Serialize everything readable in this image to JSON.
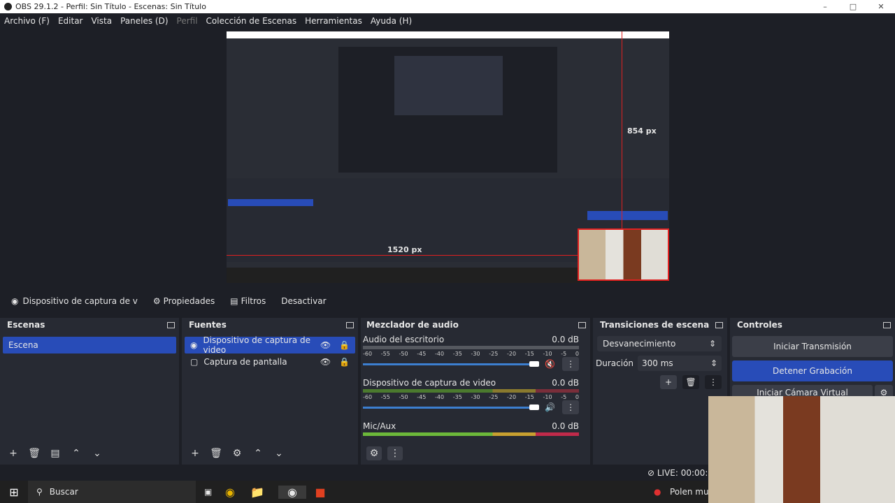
{
  "window": {
    "title": "OBS 29.1.2 - Perfil: Sin Título - Escenas: Sin Título"
  },
  "menu": [
    "Archivo (F)",
    "Editar",
    "Vista",
    "Paneles (D)",
    "Perfil",
    "Colección de Escenas",
    "Herramientas",
    "Ayuda (H)"
  ],
  "preview": {
    "height_label": "854 px",
    "width_label": "1520 px"
  },
  "source_toolbar": {
    "source": "Dispositivo de captura de v",
    "properties": "Propiedades",
    "filters": "Filtros",
    "deactivate": "Desactivar"
  },
  "scenes": {
    "title": "Escenas",
    "items": [
      "Escena"
    ]
  },
  "sources": {
    "title": "Fuentes",
    "items": [
      "Dispositivo de captura de video",
      "Captura de pantalla"
    ]
  },
  "mixer": {
    "title": "Mezclador de audio",
    "ticks": [
      "-60",
      "-55",
      "-50",
      "-45",
      "-40",
      "-35",
      "-30",
      "-25",
      "-20",
      "-15",
      "-10",
      "-5",
      "0"
    ],
    "channels": [
      {
        "name": "Audio del escritorio",
        "db": "0.0 dB"
      },
      {
        "name": "Dispositivo de captura de video",
        "db": "0.0 dB"
      },
      {
        "name": "Mic/Aux",
        "db": "0.0 dB"
      }
    ]
  },
  "transitions": {
    "title": "Transiciones de escena",
    "type": "Desvanecimiento",
    "duration_label": "Duración",
    "duration": "300 ms"
  },
  "controls": {
    "title": "Controles",
    "start_stream": "Iniciar Transmisión",
    "stop_record": "Detener Grabación",
    "virtual_cam": "Iniciar Cámara Virtual"
  },
  "status": {
    "live": "LIVE: 00:00:00"
  },
  "taskbar": {
    "search": "Buscar",
    "notification": "Polen muy"
  }
}
